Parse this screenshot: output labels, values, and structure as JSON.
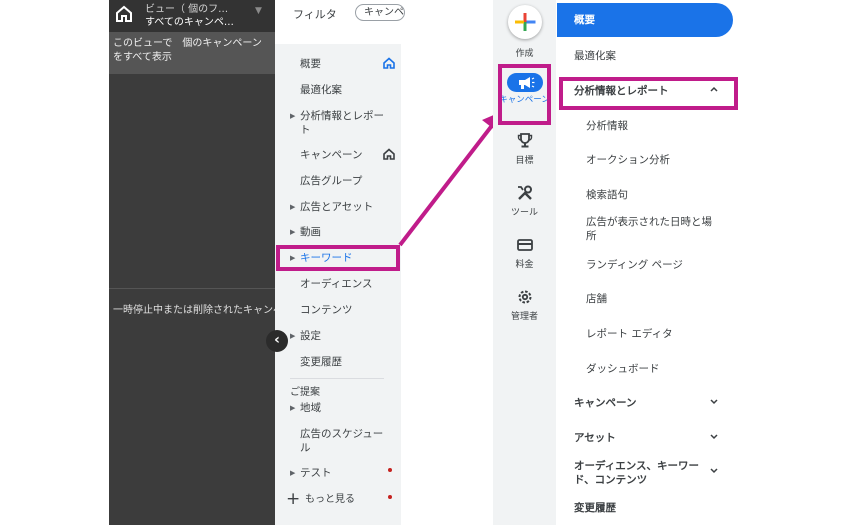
{
  "dark_panel": {
    "view_line1": "ビュー（  個のフ…",
    "view_line2": "すべてのキャンペ…",
    "caret": "▼",
    "info_text": "このビューで　個のキャンペーンをすべて表示",
    "paused_text": "一時停止中または削除されたキャンペーン"
  },
  "filter": {
    "label": "フィルタ",
    "chip": "キャンペ"
  },
  "mid_nav": {
    "items": [
      {
        "label": "概要"
      },
      {
        "label": "最適化案"
      },
      {
        "label": "分析情報とレポート"
      },
      {
        "label": "キャンペーン"
      },
      {
        "label": "広告グループ"
      },
      {
        "label": "広告とアセット"
      },
      {
        "label": "動画"
      },
      {
        "label": "キーワード"
      },
      {
        "label": "オーディエンス"
      },
      {
        "label": "コンテンツ"
      },
      {
        "label": "設定"
      },
      {
        "label": "変更履歴"
      }
    ],
    "section_label": "ご提案",
    "suggest_items": [
      {
        "label": "地域"
      },
      {
        "label": "広告のスケジュール"
      },
      {
        "label": "テスト"
      },
      {
        "label": "もっと見る"
      }
    ]
  },
  "rail": {
    "create": "作成",
    "campaign": "キャンペーン",
    "goals": "目標",
    "tools": "ツール",
    "billing": "料金",
    "admin": "管理者"
  },
  "menu": {
    "overview": "概要",
    "recommendations": "最適化案",
    "insights_reports": "分析情報とレポート",
    "sub": [
      "分析情報",
      "オークション分析",
      "検索語句",
      "広告が表示された日時と場所",
      "ランディング ページ",
      "店舗",
      "レポート エディタ",
      "ダッシュボード"
    ],
    "campaigns": "キャンペーン",
    "assets": "アセット",
    "audiences": "オーディエンス、キーワード、コンテンツ",
    "change_history": "変更履歴"
  },
  "colors": {
    "highlight": "#c01c8a",
    "accent": "#1a73e8",
    "dark_bg": "#3c3c3c"
  }
}
